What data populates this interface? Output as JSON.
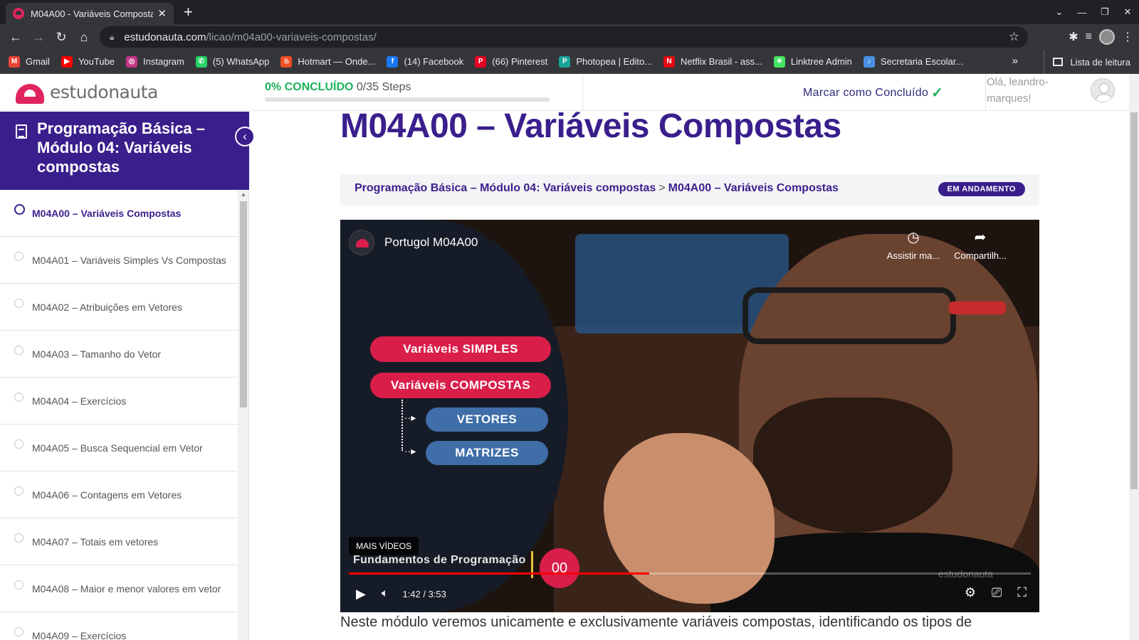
{
  "browser": {
    "tab_title": "M04A00 - Variáveis Composta",
    "url_host": "estudonauta.com",
    "url_path": "/licao/m04a00-variaveis-compostas/",
    "bookmarks": [
      {
        "label": "Gmail",
        "color": "#ea4335",
        "glyph": "M"
      },
      {
        "label": "YouTube",
        "color": "#ff0000",
        "glyph": "▶"
      },
      {
        "label": "Instagram",
        "color": "#c13584",
        "glyph": "◎"
      },
      {
        "label": "(5) WhatsApp",
        "color": "#25d366",
        "glyph": "✆"
      },
      {
        "label": "Hotmart — Onde...",
        "color": "#f04e23",
        "glyph": "♨"
      },
      {
        "label": "(14) Facebook",
        "color": "#1877f2",
        "glyph": "f"
      },
      {
        "label": "(66) Pinterest",
        "color": "#e60023",
        "glyph": "P"
      },
      {
        "label": "Photopea | Edito...",
        "color": "#18a497",
        "glyph": "P"
      },
      {
        "label": "Netflix Brasil - ass...",
        "color": "#e50914",
        "glyph": "N"
      },
      {
        "label": "Linktree Admin",
        "color": "#43e660",
        "glyph": "✳"
      },
      {
        "label": "Secretaria Escolar...",
        "color": "#4a90e2",
        "glyph": "♪"
      }
    ],
    "reading_list": "Lista de leitura"
  },
  "header": {
    "logo_text": "estudonauta",
    "progress_percent_label": "0% CONCLUÍDO",
    "progress_steps": "0/35 Steps",
    "progress_fraction": 0.0,
    "mark_complete": "Marcar como Concluído",
    "greeting": "Olá, leandro-marques!"
  },
  "sidebar": {
    "course_title": "Programação Básica – Módulo 04: Variáveis compostas",
    "lessons": [
      {
        "label": "M04A00 – Variáveis Compostas",
        "active": true
      },
      {
        "label": "M04A01 – Variáveis Simples Vs Compostas",
        "active": false
      },
      {
        "label": "M04A02 – Atribuições em Vetores",
        "active": false
      },
      {
        "label": "M04A03 – Tamanho do Vetor",
        "active": false
      },
      {
        "label": "M04A04 – Exercícios",
        "active": false
      },
      {
        "label": "M04A05 – Busca Sequencial em Vetor",
        "active": false
      },
      {
        "label": "M04A06 – Contagens em Vetores",
        "active": false
      },
      {
        "label": "M04A07 – Totais em vetores",
        "active": false
      },
      {
        "label": "M04A08 – Maior e menor valores em vetor",
        "active": false
      },
      {
        "label": "M04A09 – Exercícios",
        "active": false
      }
    ]
  },
  "main": {
    "title": "M04A00 – Variáveis Compostas",
    "breadcrumb_course": "Programação Básica – Módulo 04: Variáveis compostas",
    "breadcrumb_sep": ">",
    "breadcrumb_lesson": "M04A00 – Variáveis Compostas",
    "status": "EM ANDAMENTO",
    "intro": "Neste módulo veremos unicamente e exclusivamente variáveis compostas, identificando os tipos de"
  },
  "video": {
    "title": "Portugol M04A00",
    "watch_later": "Assistir ma...",
    "share": "Compartilh...",
    "slide_simple": "Variáveis SIMPLES",
    "slide_composite": "Variáveis COMPOSTAS",
    "slide_vectors": "VETORES",
    "slide_matrices": "MATRIZES",
    "more_videos": "MAIS VÍDEOS",
    "lower_third": "Fundamentos de Programação",
    "lower_badge": "00",
    "watermark": "estudonauta",
    "time": "1:42 / 3:53",
    "played_fraction": 0.44
  }
}
